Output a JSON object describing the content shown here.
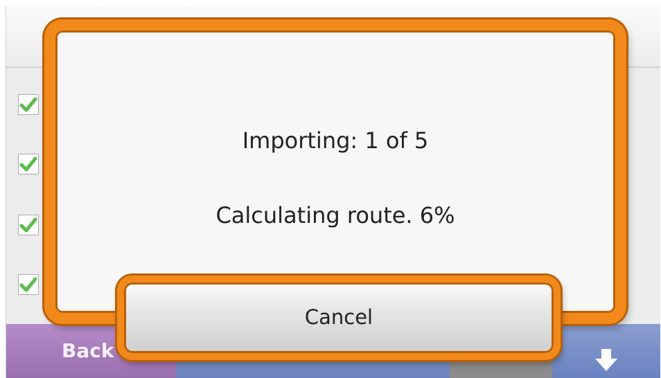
{
  "dialog": {
    "import_status": "Importing: 1 of 5",
    "route_status": "Calculating route. 6%",
    "cancel_label": "Cancel",
    "import_current": 1,
    "import_total": 5,
    "route_progress_percent": 6
  },
  "background": {
    "back_label": "Back",
    "down_icon": "arrow-down-icon",
    "checkbox_icon": "checkmark-icon",
    "checkboxes_checked": [
      true,
      true,
      true,
      true
    ]
  },
  "colors": {
    "dialog_border": "#f18a1b",
    "dialog_border_dark": "#b85f08",
    "dialog_fill": "#f7f7f7",
    "back_button": "#9a6fb0",
    "nav_button": "#7a90c8",
    "checkmark": "#5dbb4d"
  }
}
